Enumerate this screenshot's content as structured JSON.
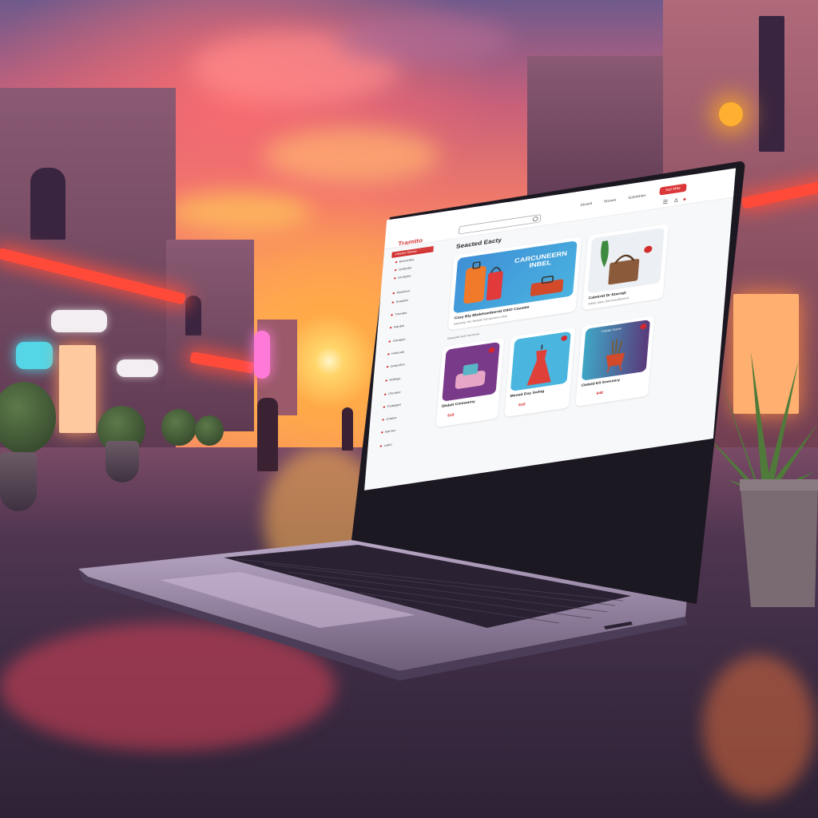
{
  "scene": {
    "colors": {
      "sky_top": "#6f5a8c",
      "sky_sun": "#ffd56a",
      "neon": "#ff4a3a",
      "ground": "#3e2d45"
    }
  },
  "store": {
    "logo": "Tramtto",
    "search_placeholder": "",
    "nav": [
      "Stoard",
      "Stosee",
      "Edmbhier"
    ],
    "cta_label": "Sut Mite",
    "section_title": "Seacted Eacty",
    "sidebar": {
      "heading": "Shepes Sclose",
      "items": [
        "Bonsettes",
        "Grbfodst",
        "Ginhyies",
        "Rpoduce",
        "Seadtes",
        "Tmedas",
        "Ranbie",
        "Grtuiges",
        "Kidscate",
        "Seapotes",
        "Rdlings",
        "Chnolee",
        "Fotbdges",
        "Grlalse",
        "Barnes",
        "Laltio"
      ]
    },
    "hero": {
      "headline": "CARCUNEERN INBEL",
      "title": "Casy Bly Bbdehaetbernd GlliO Cauwter",
      "subtitle": "Seaacty rbo bieatie ivd ameere ofee"
    },
    "feature": {
      "title": "Cabetrid Dr Etacegt",
      "subtitle": "Adals laelu biel bnudleceed"
    },
    "divider_label": "Saaeptd acd eorerary",
    "products": [
      {
        "title": "Sbdalt Cnmwamy",
        "price": "$18",
        "icon": "bag-icon"
      },
      {
        "title": "Menad Day Swhig",
        "price": "$18",
        "icon": "dress-icon"
      },
      {
        "title": "Cbdeld Ell Snecoary",
        "price": "$48",
        "icon": "plant-pot-icon",
        "tag": "Cebbrl Gume"
      }
    ]
  }
}
